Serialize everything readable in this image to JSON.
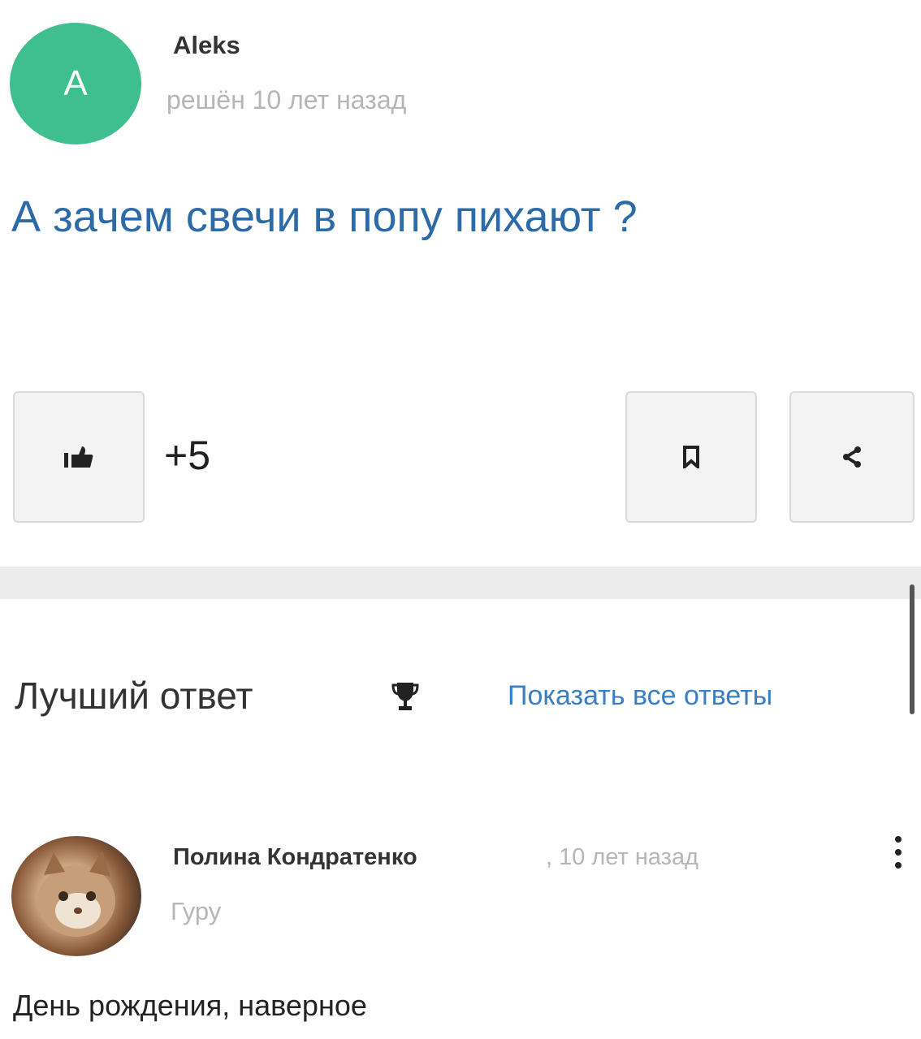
{
  "question": {
    "author": {
      "initial": "A",
      "name": "Aleks",
      "meta": "решён 10 лет назад"
    },
    "text": "А зачем свечи в попу пихают ?",
    "likes": "+5"
  },
  "best_answer": {
    "title": "Лучший ответ",
    "show_all": "Показать все ответы"
  },
  "answer": {
    "author": "Полина Кондратенко",
    "time": ", 10 лет назад",
    "rank": "Гуру",
    "text": "День рождения, наверное"
  },
  "icons": {
    "like": "thumbs-up-icon",
    "save": "bookmark-icon",
    "share": "share-icon",
    "trophy": "trophy-icon",
    "menu": "more-vertical-icon"
  },
  "colors": {
    "avatar": "#3fbf8f",
    "question_text": "#2d6aa8",
    "link": "#3a7fc4",
    "muted": "#b6b6b6"
  }
}
